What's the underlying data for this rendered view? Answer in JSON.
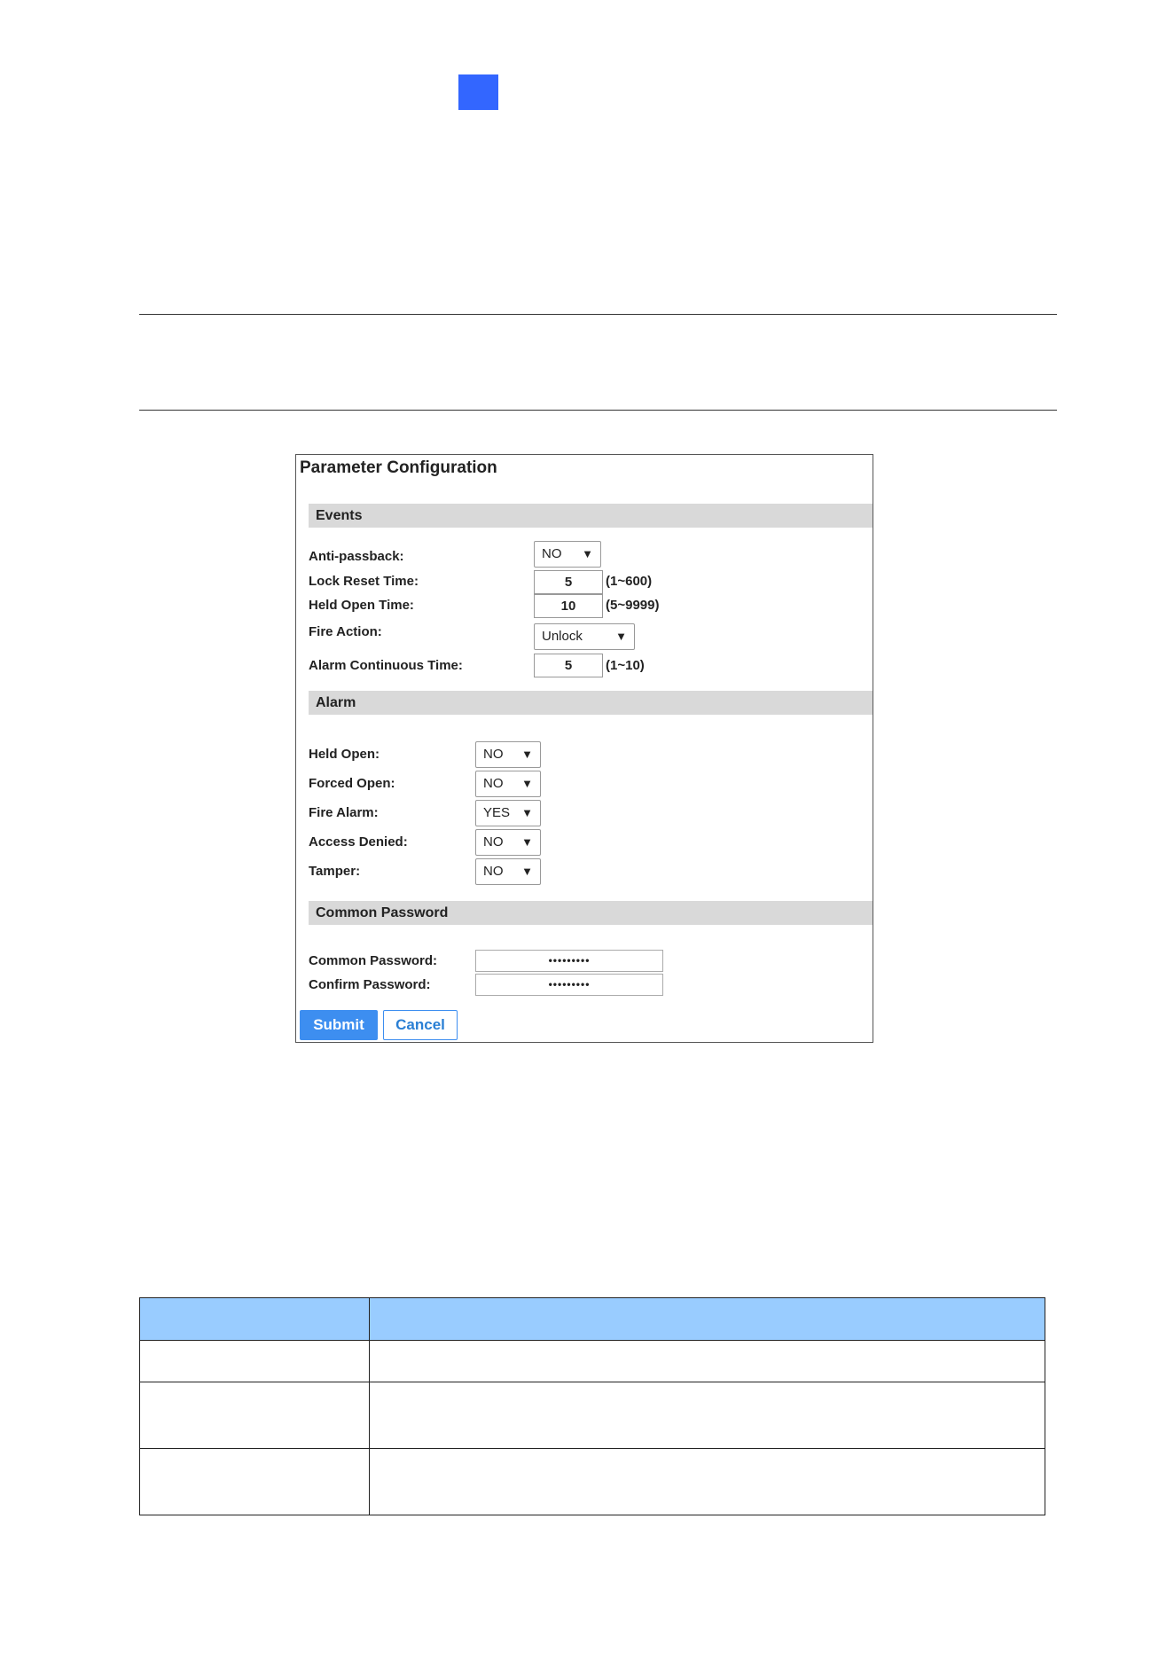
{
  "config": {
    "title": "Parameter Configuration",
    "events": {
      "header": "Events",
      "anti_passback": {
        "label": "Anti-passback:",
        "value": "NO"
      },
      "lock_reset_time": {
        "label": "Lock Reset Time:",
        "value": "5",
        "range": "(1~600)"
      },
      "held_open_time": {
        "label": "Held Open Time:",
        "value": "10",
        "range": "(5~9999)"
      },
      "fire_action": {
        "label": "Fire Action:",
        "value": "Unlock"
      },
      "alarm_continuous_time": {
        "label": "Alarm Continuous Time:",
        "value": "5",
        "range": "(1~10)"
      }
    },
    "alarm": {
      "header": "Alarm",
      "held_open": {
        "label": "Held Open:",
        "value": "NO"
      },
      "forced_open": {
        "label": "Forced Open:",
        "value": "NO"
      },
      "fire_alarm": {
        "label": "Fire Alarm:",
        "value": "YES"
      },
      "access_denied": {
        "label": "Access Denied:",
        "value": "NO"
      },
      "tamper": {
        "label": "Tamper:",
        "value": "NO"
      }
    },
    "common_password": {
      "header": "Common Password",
      "password": {
        "label": "Common Password:",
        "value": "•••••••••"
      },
      "confirm": {
        "label": "Confirm Password:",
        "value": "•••••••••"
      }
    },
    "buttons": {
      "submit": "Submit",
      "cancel": "Cancel"
    }
  },
  "icons": {
    "dropdown": "▼"
  },
  "colors": {
    "accent_square": "#3366ff",
    "section_bar": "#d9d9d9",
    "submit_button": "#3d8ef0",
    "table_header": "#99ccff"
  }
}
